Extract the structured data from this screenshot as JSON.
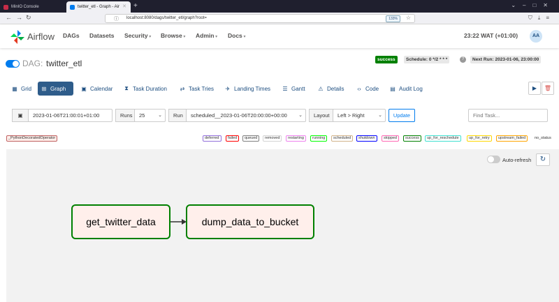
{
  "browser": {
    "tabs": [
      {
        "title": "MinIO Console",
        "favicon_color": "#c72c48",
        "active": false
      },
      {
        "title": "twitter_etl - Graph - Air",
        "favicon_color": "#017cee",
        "active": true
      }
    ],
    "url": "localhost:8080/dags/twitter_etl/graph?root=",
    "zoom": "133%"
  },
  "header": {
    "brand": "Airflow",
    "menu": [
      "DAGs",
      "Datasets",
      "Security",
      "Browse",
      "Admin",
      "Docs"
    ],
    "clock": "23:22 WAT (+01:00)",
    "avatar": "AA"
  },
  "dag": {
    "prefix": "DAG:",
    "name": "twitter_etl",
    "status": "success",
    "schedule": "Schedule: 0 */2 * * *",
    "next_run": "Next Run: 2023-01-06, 23:00:00"
  },
  "views": [
    {
      "label": "Grid",
      "icon": "grid-icon"
    },
    {
      "label": "Graph",
      "icon": "graph-icon",
      "active": true
    },
    {
      "label": "Calendar",
      "icon": "calendar-icon"
    },
    {
      "label": "Task Duration",
      "icon": "hourglass-icon"
    },
    {
      "label": "Task Tries",
      "icon": "retry-icon"
    },
    {
      "label": "Landing Times",
      "icon": "plane-icon"
    },
    {
      "label": "Gantt",
      "icon": "gantt-icon"
    },
    {
      "label": "Details",
      "icon": "warning-icon"
    },
    {
      "label": "Code",
      "icon": "code-icon"
    },
    {
      "label": "Audit Log",
      "icon": "log-icon"
    }
  ],
  "controls": {
    "base_date": "2023-01-06T21:00:01+01:00",
    "runs_label": "Runs",
    "runs_value": "25",
    "run_label": "Run",
    "run_value": "scheduled__2023-01-06T20:00:00+00:00",
    "layout_label": "Layout",
    "layout_value": "Left > Right",
    "update": "Update",
    "find_placeholder": "Find Task..."
  },
  "legend": {
    "operator": "_PythonDecoratedOperator",
    "states": [
      {
        "label": "deferred",
        "color": "#9370db"
      },
      {
        "label": "failed",
        "color": "#ff0000"
      },
      {
        "label": "queued",
        "color": "#808080"
      },
      {
        "label": "removed",
        "color": "#d3d3d3"
      },
      {
        "label": "restarting",
        "color": "#ee82ee"
      },
      {
        "label": "running",
        "color": "#00ff00"
      },
      {
        "label": "scheduled",
        "color": "#d2b48c"
      },
      {
        "label": "shutdown",
        "color": "#0000ff"
      },
      {
        "label": "skipped",
        "color": "#ff69b4"
      },
      {
        "label": "success",
        "color": "#008000"
      },
      {
        "label": "up_for_reschedule",
        "color": "#40e0d0"
      },
      {
        "label": "up_for_retry",
        "color": "#ffd700"
      },
      {
        "label": "upstream_failed",
        "color": "#ffa500"
      }
    ],
    "no_status": "no_status"
  },
  "graph": {
    "auto_refresh": "Auto-refresh",
    "nodes": [
      "get_twitter_data",
      "dump_data_to_bucket"
    ]
  }
}
